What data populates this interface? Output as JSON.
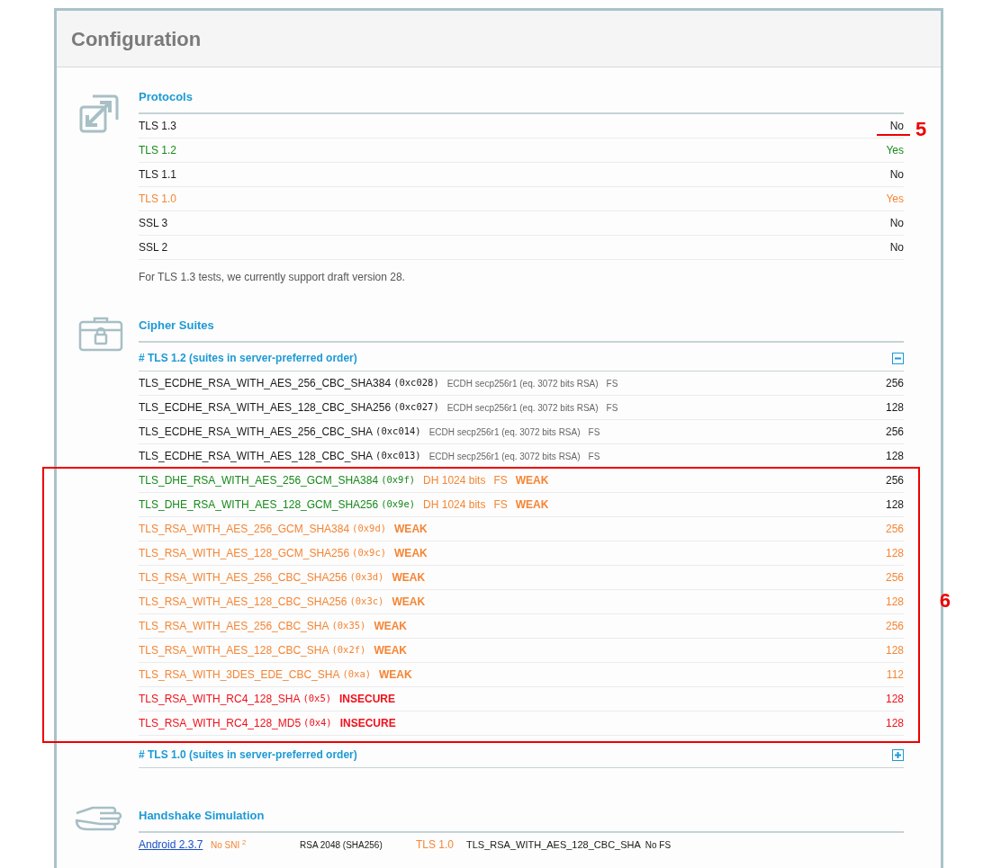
{
  "title": "Configuration",
  "protocols": {
    "heading": "Protocols",
    "rows": [
      {
        "name": "TLS 1.3",
        "value": "No",
        "color": "#1a1a1a",
        "annotation": "5"
      },
      {
        "name": "TLS 1.2",
        "value": "Yes",
        "color": "#168a1a"
      },
      {
        "name": "TLS 1.1",
        "value": "No",
        "color": "#1a1a1a"
      },
      {
        "name": "TLS 1.0",
        "value": "Yes",
        "color": "#f58535"
      },
      {
        "name": "SSL 3",
        "value": "No",
        "color": "#1a1a1a"
      },
      {
        "name": "SSL 2",
        "value": "No",
        "color": "#1a1a1a"
      }
    ],
    "note": "For TLS 1.3 tests, we currently support draft version 28."
  },
  "cipher_suites": {
    "heading": "Cipher Suites",
    "highlight_label": "6",
    "groups": [
      {
        "title": "# TLS 1.2 (suites in server-preferred order)",
        "expanded": true,
        "suites": [
          {
            "name": "TLS_ECDHE_RSA_WITH_AES_256_CBC_SHA384",
            "code": "(0xc028)",
            "color": "#1a1a1a",
            "highlighted": false,
            "details": [
              {
                "kind": "note",
                "text": "ECDH secp256r1 (eq. 3072 bits RSA)"
              },
              {
                "kind": "note",
                "text": "FS"
              }
            ],
            "strength": {
              "text": "256",
              "color": "#1a1a1a"
            }
          },
          {
            "name": "TLS_ECDHE_RSA_WITH_AES_128_CBC_SHA256",
            "code": "(0xc027)",
            "color": "#1a1a1a",
            "highlighted": false,
            "details": [
              {
                "kind": "note",
                "text": "ECDH secp256r1 (eq. 3072 bits RSA)"
              },
              {
                "kind": "note",
                "text": "FS"
              }
            ],
            "strength": {
              "text": "128",
              "color": "#1a1a1a"
            }
          },
          {
            "name": "TLS_ECDHE_RSA_WITH_AES_256_CBC_SHA",
            "code": "(0xc014)",
            "color": "#1a1a1a",
            "highlighted": false,
            "details": [
              {
                "kind": "note",
                "text": "ECDH secp256r1 (eq. 3072 bits RSA)"
              },
              {
                "kind": "note",
                "text": "FS"
              }
            ],
            "strength": {
              "text": "256",
              "color": "#1a1a1a"
            }
          },
          {
            "name": "TLS_ECDHE_RSA_WITH_AES_128_CBC_SHA",
            "code": "(0xc013)",
            "color": "#1a1a1a",
            "highlighted": false,
            "details": [
              {
                "kind": "note",
                "text": "ECDH secp256r1 (eq. 3072 bits RSA)"
              },
              {
                "kind": "note",
                "text": "FS"
              }
            ],
            "strength": {
              "text": "128",
              "color": "#1a1a1a"
            }
          },
          {
            "name": "TLS_DHE_RSA_WITH_AES_256_GCM_SHA384",
            "code": "(0x9f)",
            "color": "#168a1a",
            "highlighted": true,
            "details": [
              {
                "kind": "warn",
                "text": "DH 1024 bits"
              },
              {
                "kind": "warn",
                "text": "FS"
              },
              {
                "kind": "weak",
                "text": "WEAK"
              }
            ],
            "strength": {
              "text": "256",
              "color": "#1a1a1a"
            }
          },
          {
            "name": "TLS_DHE_RSA_WITH_AES_128_GCM_SHA256",
            "code": "(0x9e)",
            "color": "#168a1a",
            "highlighted": true,
            "details": [
              {
                "kind": "warn",
                "text": "DH 1024 bits"
              },
              {
                "kind": "warn",
                "text": "FS"
              },
              {
                "kind": "weak",
                "text": "WEAK"
              }
            ],
            "strength": {
              "text": "128",
              "color": "#1a1a1a"
            }
          },
          {
            "name": "TLS_RSA_WITH_AES_256_GCM_SHA384",
            "code": "(0x9d)",
            "color": "#f58535",
            "highlighted": true,
            "details": [
              {
                "kind": "weak",
                "text": "WEAK"
              }
            ],
            "strength": {
              "text": "256",
              "color": "#f58535"
            }
          },
          {
            "name": "TLS_RSA_WITH_AES_128_GCM_SHA256",
            "code": "(0x9c)",
            "color": "#f58535",
            "highlighted": true,
            "details": [
              {
                "kind": "weak",
                "text": "WEAK"
              }
            ],
            "strength": {
              "text": "128",
              "color": "#f58535"
            }
          },
          {
            "name": "TLS_RSA_WITH_AES_256_CBC_SHA256",
            "code": "(0x3d)",
            "color": "#f58535",
            "highlighted": true,
            "details": [
              {
                "kind": "weak",
                "text": "WEAK"
              }
            ],
            "strength": {
              "text": "256",
              "color": "#f58535"
            }
          },
          {
            "name": "TLS_RSA_WITH_AES_128_CBC_SHA256",
            "code": "(0x3c)",
            "color": "#f58535",
            "highlighted": true,
            "details": [
              {
                "kind": "weak",
                "text": "WEAK"
              }
            ],
            "strength": {
              "text": "128",
              "color": "#f58535"
            }
          },
          {
            "name": "TLS_RSA_WITH_AES_256_CBC_SHA",
            "code": "(0x35)",
            "color": "#f58535",
            "highlighted": true,
            "details": [
              {
                "kind": "weak",
                "text": "WEAK"
              }
            ],
            "strength": {
              "text": "256",
              "color": "#f58535"
            }
          },
          {
            "name": "TLS_RSA_WITH_AES_128_CBC_SHA",
            "code": "(0x2f)",
            "color": "#f58535",
            "highlighted": true,
            "details": [
              {
                "kind": "weak",
                "text": "WEAK"
              }
            ],
            "strength": {
              "text": "128",
              "color": "#f58535"
            }
          },
          {
            "name": "TLS_RSA_WITH_3DES_EDE_CBC_SHA",
            "code": "(0xa)",
            "color": "#f58535",
            "highlighted": true,
            "details": [
              {
                "kind": "weak",
                "text": "WEAK"
              }
            ],
            "strength": {
              "text": "112",
              "color": "#f58535"
            }
          },
          {
            "name": "TLS_RSA_WITH_RC4_128_SHA",
            "code": "(0x5)",
            "color": "#f0101a",
            "highlighted": true,
            "details": [
              {
                "kind": "insecure",
                "text": "INSECURE"
              }
            ],
            "strength": {
              "text": "128",
              "color": "#f0101a"
            }
          },
          {
            "name": "TLS_RSA_WITH_RC4_128_MD5",
            "code": "(0x4)",
            "color": "#f0101a",
            "highlighted": true,
            "details": [
              {
                "kind": "insecure",
                "text": "INSECURE"
              }
            ],
            "strength": {
              "text": "128",
              "color": "#f0101a"
            }
          }
        ]
      },
      {
        "title": "# TLS 1.0 (suites in server-preferred order)",
        "expanded": false
      }
    ]
  },
  "handshake_simulation": {
    "heading": "Handshake Simulation",
    "rows": [
      {
        "client": "Android 2.3.7",
        "sni": "No SNI $^{2}$",
        "cert": "RSA 2048 (SHA256)",
        "protocol": "TLS 1.0",
        "color": "#f58535",
        "suite": "TLS_RSA_WITH_AES_128_CBC_SHA",
        "fs": "No FS"
      }
    ]
  }
}
